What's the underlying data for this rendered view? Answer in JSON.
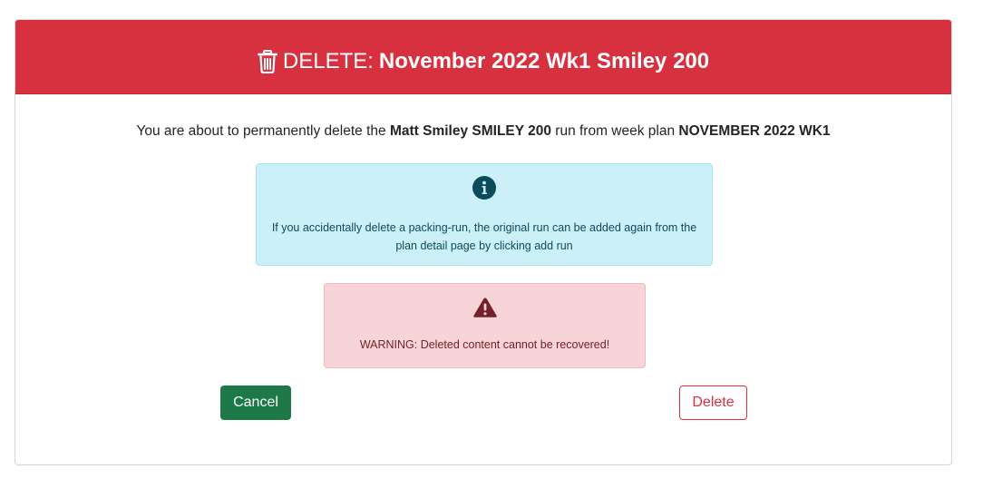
{
  "header": {
    "prefix": "DELETE:",
    "plan_name": "November 2022 Wk1 Smiley 200",
    "icon": "trash-icon",
    "color": "#d7303f"
  },
  "intro": {
    "text_before": "You are about to permanently delete the",
    "run_name": "Matt Smiley SMILEY 200",
    "text_middle": "run from week plan",
    "week_plan": "NOVEMBER 2022 WK1"
  },
  "info": {
    "icon": "info-circle-icon",
    "text": "If you accidentally delete a packing-run, the original run can be added again from the plan detail page by clicking add run"
  },
  "warning": {
    "icon": "warning-triangle-icon",
    "text": "WARNING: Deleted content cannot be recovered!"
  },
  "actions": {
    "cancel_label": "Cancel",
    "delete_label": "Delete",
    "cancel_color": "#1d7a48",
    "delete_color": "#d7303f"
  }
}
